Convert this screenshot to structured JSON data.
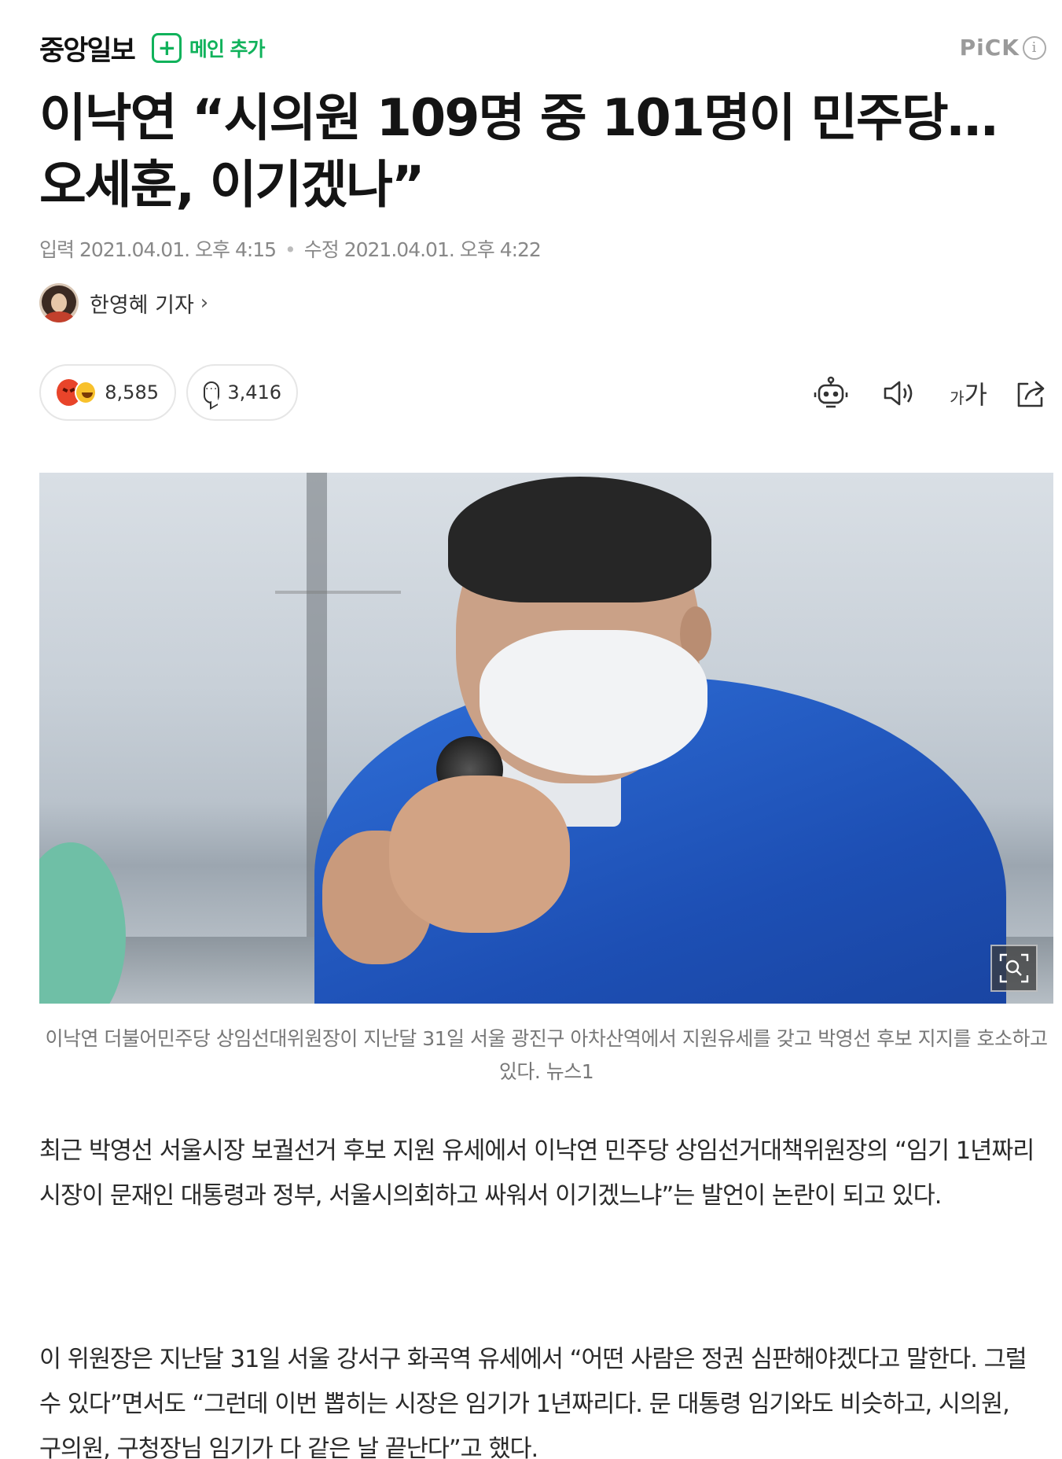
{
  "header": {
    "press_name": "중앙일보",
    "add_main_label": "메인 추가",
    "pick_label": "PiCK",
    "pick_info_symbol": "i"
  },
  "article": {
    "headline": "이낙연 “시의원 109명 중 101명이 민주당…오세훈, 이기겠나”",
    "input_label": "입력",
    "input_date": "2021.04.01. 오후 4:15",
    "modified_label": "수정",
    "modified_date": "2021.04.01. 오후 4:22",
    "reporter": "한영혜 기자",
    "reporter_chevron": "›"
  },
  "actions": {
    "reaction_count": "8,585",
    "comment_count": "3,416",
    "font_small": "가",
    "font_big": "가",
    "icons": [
      "angry-face-icon",
      "happy-face-icon",
      "comment-bubble-icon",
      "robot-summary-icon",
      "speaker-icon",
      "font-size-icon",
      "share-icon",
      "zoom-icon"
    ]
  },
  "photo": {
    "caption": "이낙연 더불어민주당 상임선대위원장이 지난달 31일 서울 광진구 아차산역에서 지원유세를 갖고 박영선 후보 지지를 호소하고 있다. 뉴스1"
  },
  "body": {
    "paragraph1": "최근 박영선 서울시장 보궐선거 후보 지원 유세에서 이낙연 민주당 상임선거대책위원장의 “임기 1년짜리 시장이 문재인 대통령과 정부, 서울시의회하고 싸워서 이기겠느냐”는 발언이 논란이 되고 있다.",
    "paragraph2": "이 위원장은 지난달 31일 서울 강서구 화곡역 유세에서 “어떤 사람은 정권 심판해야겠다고 말한다. 그럴 수 있다”면서도 “그런데 이번 뽑히는 시장은 임기가 1년짜리다. 문 대통령 임기와도 비슷하고, 시의원, 구의원, 구청장님 임기가 다 같은 날 끝난다”고 했다."
  },
  "colors": {
    "brand_green": "#10b25b",
    "jacket_blue": "#1d4fb4"
  }
}
